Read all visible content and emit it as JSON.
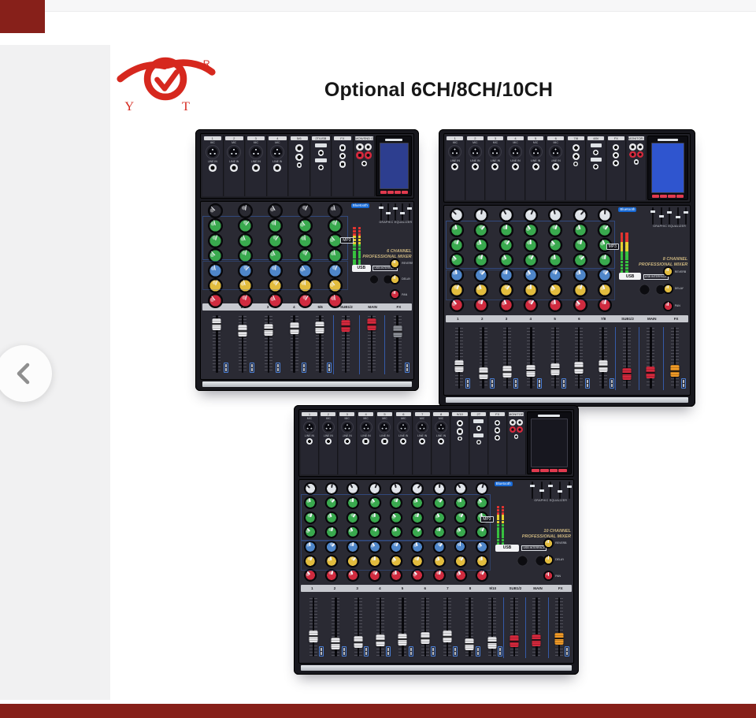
{
  "page": {
    "title": "Optional 6CH/8CH/10CH"
  },
  "brand": {
    "registered": "R",
    "letter_left": "Y",
    "letter_right": "T"
  },
  "icons": {
    "prev": "chevron-left"
  },
  "theme": {
    "accent_red": "#87201a",
    "side_panel": "#f1f1f2",
    "logo_red": "#d6281e",
    "knob_gain": "#2a2a32",
    "knob_gain_light": "#dfe3e8",
    "knob_eq": "#39a94e",
    "knob_aux": "#4f86c9",
    "knob_pan": "#e2bc3e",
    "knob_level": "#d02b3f",
    "cap_w": "#e6e6e9",
    "cap_r": "#d5293d",
    "cap_o": "#f09a27",
    "cap_g": "#8a8d94",
    "led_red": "#e2332f",
    "led_yellow": "#e8d12f",
    "led_green": "#37c23f"
  },
  "shared": {
    "mic": "MIC",
    "line_in": "LINE IN",
    "bluetooth": "Bluetooth",
    "mp3": "MP3",
    "usb": "USB",
    "interface": "USB INTERFACE",
    "eq_caption": "GRAPHIC EQUALIZER",
    "master_labels": [
      "REVERB",
      "DELAY",
      "PAN"
    ]
  },
  "mixers": [
    {
      "name": "6ch",
      "model": [
        "6 CHANNEL",
        "PROFESSIONAL MIXER"
      ],
      "mics": 4,
      "cols": 5,
      "gain_light": false,
      "jack_labels": [
        "1",
        "2",
        "3",
        "4",
        "5/6",
        "2T/USB",
        "FX",
        "MON/SND OUT"
      ],
      "fader_labels": [
        "1",
        "2",
        "3",
        "4",
        "5/6",
        "SUB1/2",
        "MAIN",
        "FX"
      ],
      "caps": [
        "w",
        "w",
        "w",
        "w",
        "w",
        "r",
        "r",
        "g"
      ],
      "screen": "#2d3e8f",
      "cap_level": 0.14
    },
    {
      "name": "8ch",
      "model": [
        "8 CHANNEL",
        "PROFESSIONAL MIXER"
      ],
      "mics": 6,
      "cols": 7,
      "gain_light": true,
      "jack_labels": [
        "1",
        "2",
        "3",
        "4",
        "5",
        "6",
        "7/8",
        "48V",
        "FX",
        "MONITOR OUT"
      ],
      "fader_labels": [
        "1",
        "2",
        "3",
        "4",
        "5",
        "6",
        "7/8",
        "SUB1/2",
        "MAIN",
        "FX"
      ],
      "caps": [
        "w",
        "w",
        "w",
        "w",
        "w",
        "w",
        "w",
        "r",
        "r",
        "o"
      ],
      "screen": "#2f55cf",
      "cap_level": 0.58
    },
    {
      "name": "10ch",
      "model": [
        "10 CHANNEL",
        "PROFESSIONAL MIXER"
      ],
      "mics": 8,
      "cols": 9,
      "gain_light": true,
      "jack_labels": [
        "1",
        "2",
        "3",
        "4",
        "5",
        "6",
        "7",
        "8",
        "9/10",
        "2T",
        "FX",
        "MONITOR OUT"
      ],
      "fader_labels": [
        "1",
        "2",
        "3",
        "4",
        "5",
        "6",
        "7",
        "8",
        "9/10",
        "SUB1/2",
        "MAIN",
        "FX"
      ],
      "caps": [
        "w",
        "w",
        "w",
        "w",
        "w",
        "w",
        "w",
        "w",
        "w",
        "r",
        "r",
        "o"
      ],
      "screen": "#17171f",
      "cap_level": 0.6
    }
  ]
}
